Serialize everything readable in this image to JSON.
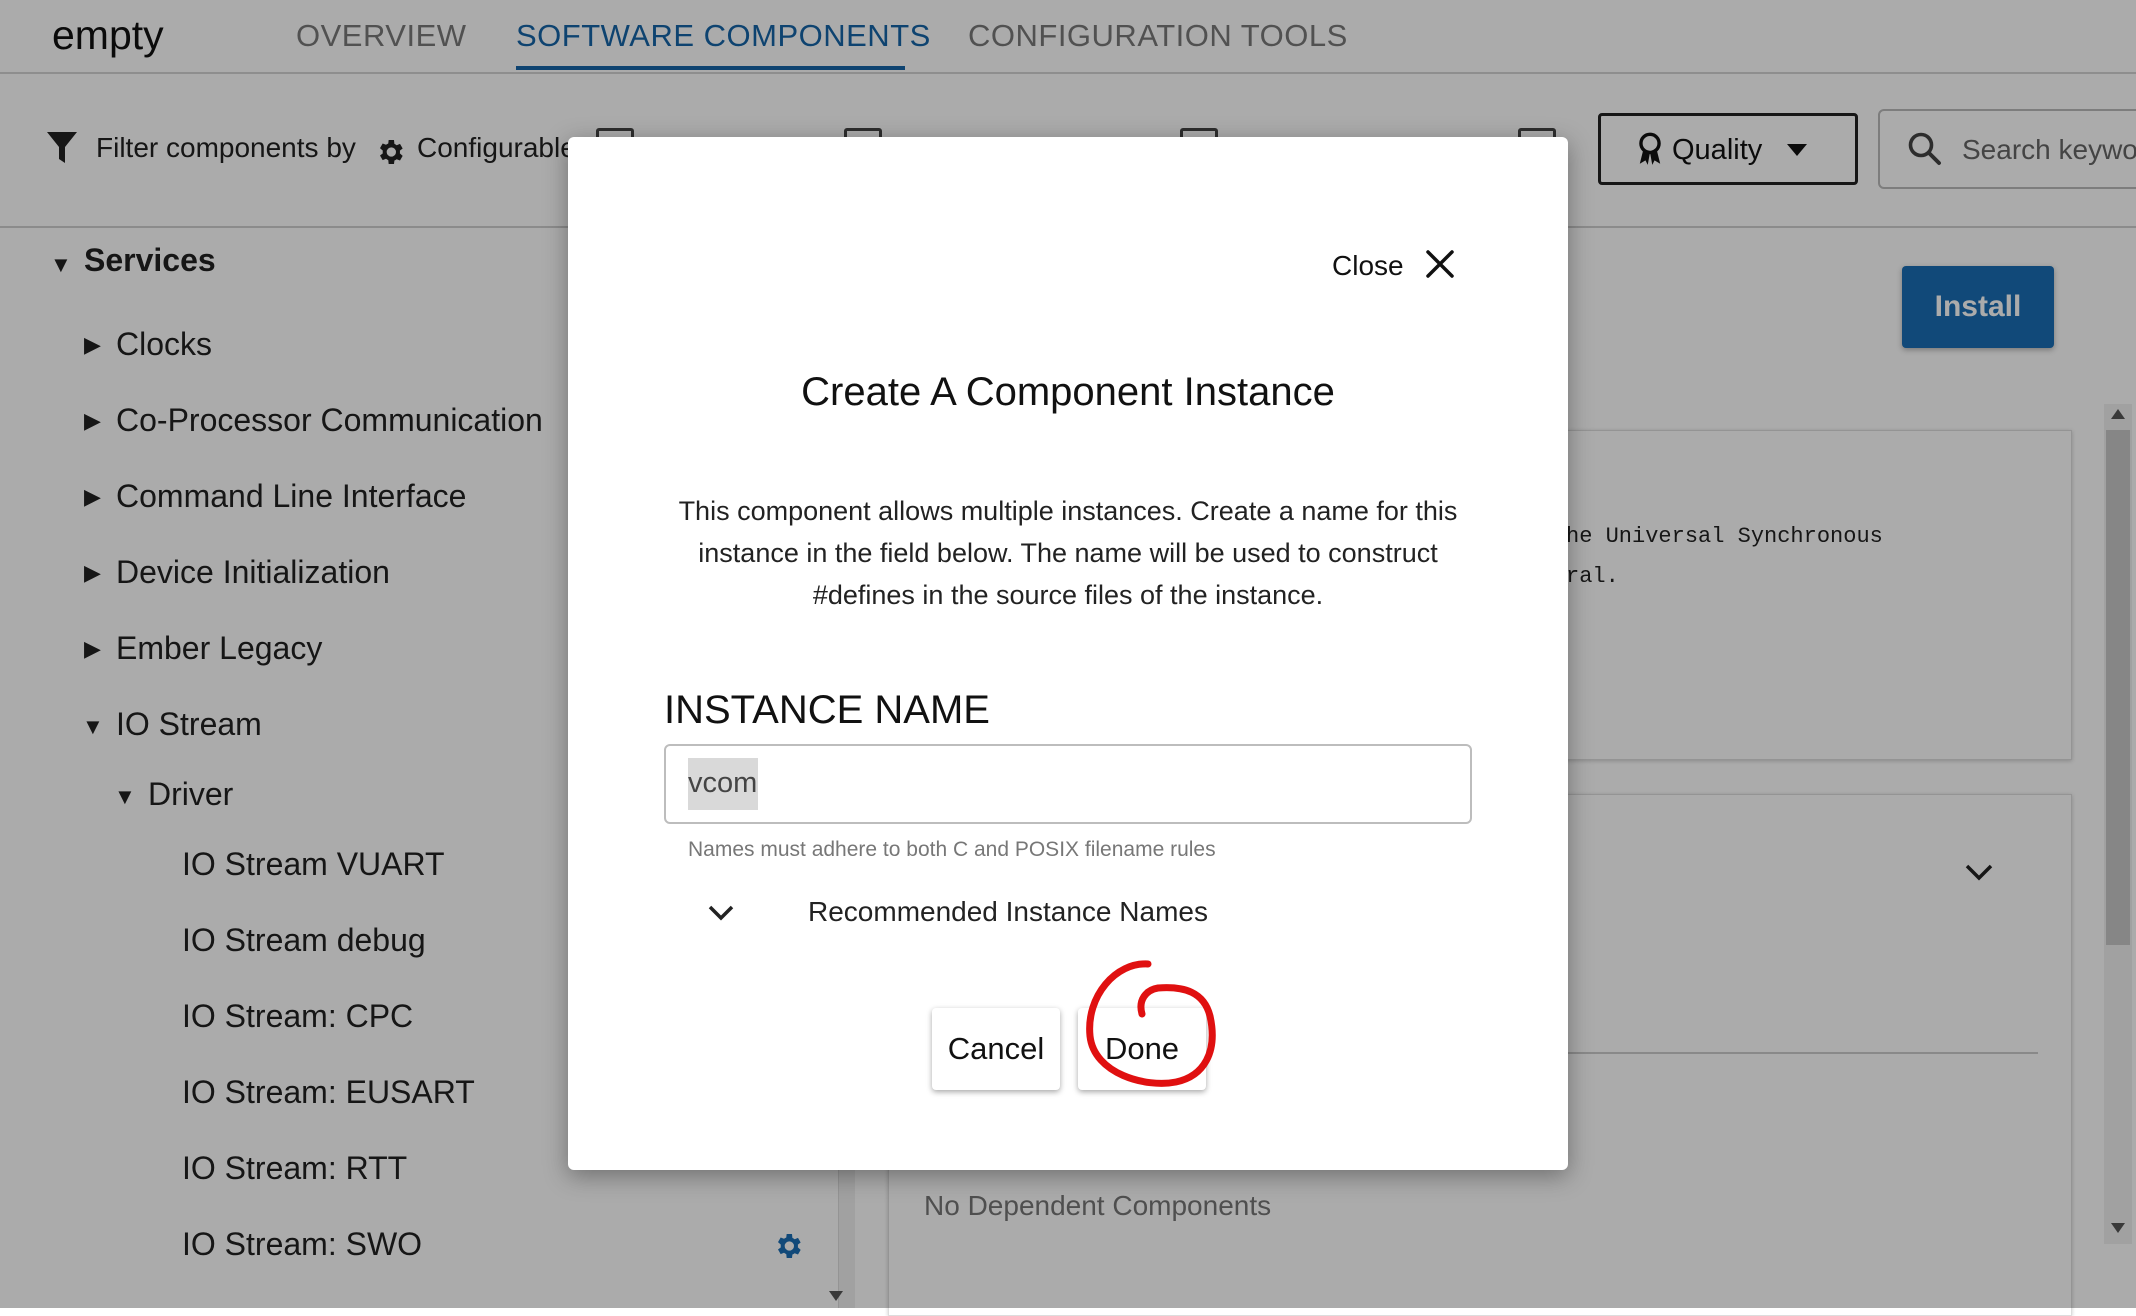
{
  "header": {
    "app_title": "empty",
    "tabs": [
      "OVERVIEW",
      "SOFTWARE COMPONENTS",
      "CONFIGURATION TOOLS"
    ],
    "active_tab": "SOFTWARE COMPONENTS"
  },
  "filter_bar": {
    "filter_label": "Filter components by",
    "configurable_label": "Configurable",
    "quality_label": "Quality",
    "search_placeholder": "Search keywo"
  },
  "tree": {
    "root": "Services",
    "items": [
      "Clocks",
      "Co-Processor Communication",
      "Command Line Interface",
      "Device Initialization",
      "Ember Legacy",
      "IO Stream"
    ],
    "io_stream_child": "Driver",
    "driver_items": [
      "IO Stream VUART",
      "IO Stream debug",
      "IO Stream: CPC",
      "IO Stream: EUSART",
      "IO Stream: RTT",
      "IO Stream: SWO"
    ]
  },
  "right_panel": {
    "install_label": "Install",
    "desc_line1": "he Universal Synchronous",
    "desc_line2": "ral.",
    "dependents_text": "No Dependent Components"
  },
  "modal": {
    "close_label": "Close",
    "title": "Create A Component Instance",
    "description": "This component allows multiple instances. Create a name for this instance in the field below. The name will be used to construct #defines in the source files of the instance.",
    "instance_label": "INSTANCE NAME",
    "instance_value": "vcom",
    "helper_text": "Names must adhere to both C and POSIX filename rules",
    "recommended_label": "Recommended Instance Names",
    "cancel_label": "Cancel",
    "done_label": "Done"
  },
  "colors": {
    "accent": "#1565a8",
    "install_button": "#1a6eb5",
    "annotation": "#e01010"
  }
}
